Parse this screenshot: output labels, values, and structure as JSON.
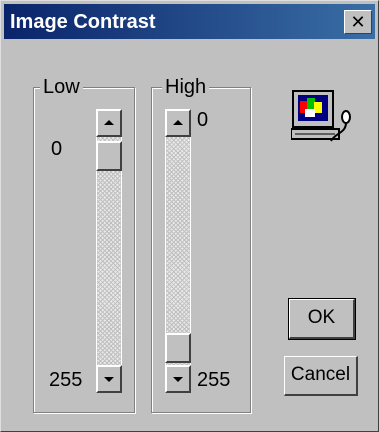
{
  "window": {
    "title": "Image Contrast",
    "close_glyph": "✕"
  },
  "low": {
    "label": "Low",
    "min_label": "0",
    "max_label": "255",
    "value": 0
  },
  "high": {
    "label": "High",
    "min_label": "0",
    "max_label": "255",
    "value": 255
  },
  "buttons": {
    "ok": "OK",
    "cancel": "Cancel"
  },
  "icon": {
    "name": "computer-monitor-icon"
  },
  "colors": {
    "titlebar_start": "#0a246a",
    "titlebar_end": "#3a6ea5",
    "face": "#c0c0c0"
  }
}
